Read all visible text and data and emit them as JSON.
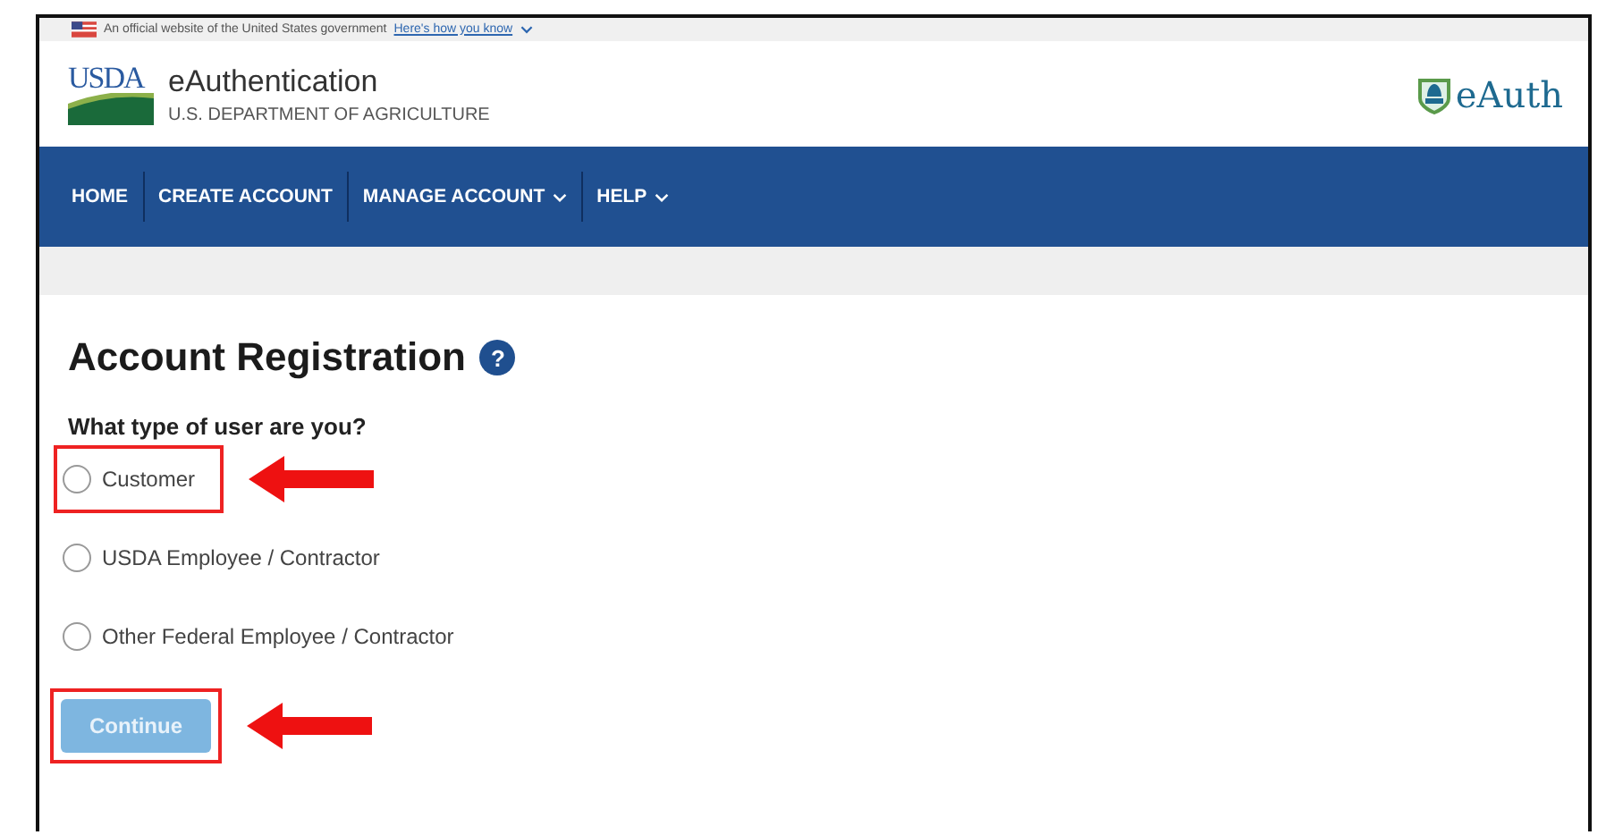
{
  "gov_banner": {
    "text": "An official website of the United States government",
    "link": "Here's how you know"
  },
  "header": {
    "logo_text": "USDA",
    "title": "eAuthentication",
    "subtitle": "U.S. DEPARTMENT OF AGRICULTURE",
    "brand": "eAuth"
  },
  "nav": [
    {
      "label": "HOME",
      "has_menu": false
    },
    {
      "label": "CREATE ACCOUNT",
      "has_menu": false
    },
    {
      "label": "MANAGE ACCOUNT",
      "has_menu": true
    },
    {
      "label": "HELP",
      "has_menu": true
    }
  ],
  "page": {
    "title": "Account Registration",
    "help": "?",
    "question": "What type of user are you?"
  },
  "options": [
    {
      "label": "Customer",
      "selected": false,
      "highlighted": true
    },
    {
      "label": "USDA Employee / Contractor",
      "selected": false,
      "highlighted": false
    },
    {
      "label": "Other Federal Employee / Contractor",
      "selected": false,
      "highlighted": false
    }
  ],
  "continue_button": {
    "label": "Continue",
    "disabled": true,
    "highlighted": true
  }
}
